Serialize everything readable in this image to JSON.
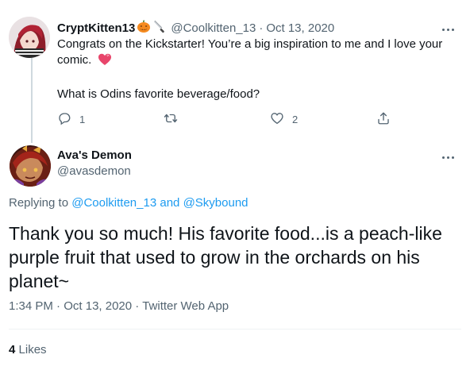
{
  "reply": {
    "display_name": "CryptKitten13",
    "handle": "@Coolkitten_13",
    "separator": "·",
    "date": "Oct 13, 2020",
    "text_line1": "Congrats on the Kickstarter! You’re a big inspiration to me and I love your comic.",
    "text_line2": "What is Odins favorite beverage/food?",
    "actions": {
      "reply_count": "1",
      "retweet_count": "",
      "like_count": "2"
    },
    "emoji_names": [
      "jack-o-lantern-icon",
      "knife-icon",
      "heart-icon"
    ]
  },
  "main": {
    "display_name": "Ava's Demon",
    "handle": "@avasdemon",
    "replying_prefix": "Replying to",
    "replying_user1": "@Coolkitten_13",
    "replying_and": "and",
    "replying_user2": "@Skybound",
    "text": "Thank you so much! His favorite food...is a peach-like purple fruit that used to grow in the orchards on his planet~",
    "time": "1:34 PM",
    "separator": "·",
    "date": "Oct 13, 2020",
    "source": "Twitter Web App",
    "likes_count": "4",
    "likes_label": "Likes"
  },
  "colors": {
    "text": "#0f1419",
    "secondary": "#536471",
    "link": "#1d9bf0",
    "line": "#cfd9de",
    "divider": "#eff3f4"
  }
}
